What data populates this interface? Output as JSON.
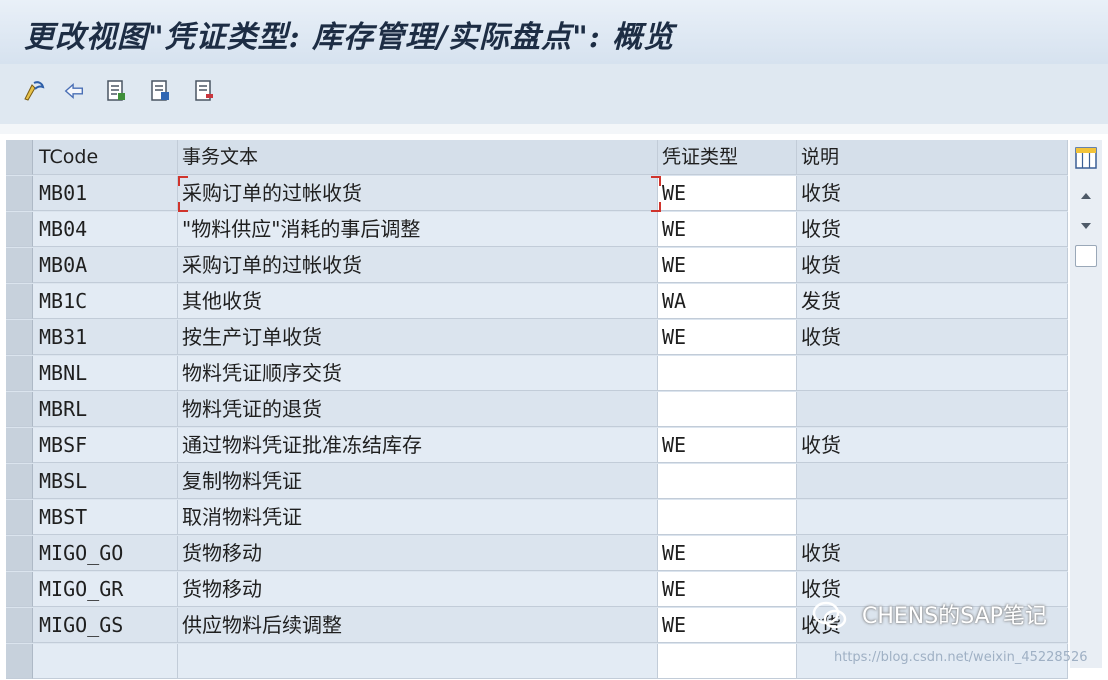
{
  "title": "更改视图\"凭证类型: 库存管理/实际盘点\": 概览",
  "toolbar": {
    "icons": [
      "edit-icon",
      "undo-icon",
      "new-entries-icon",
      "copy-icon",
      "delete-icon"
    ]
  },
  "table": {
    "headers": [
      "TCode",
      "事务文本",
      "凭证类型",
      "说明"
    ],
    "rows": [
      {
        "tcode": "MB01",
        "text": "采购订单的过帐收货",
        "doctype": "WE",
        "desc": "收货"
      },
      {
        "tcode": "MB04",
        "text": "\"物料供应\"消耗的事后调整",
        "doctype": "WE",
        "desc": "收货"
      },
      {
        "tcode": "MB0A",
        "text": "采购订单的过帐收货",
        "doctype": "WE",
        "desc": "收货"
      },
      {
        "tcode": "MB1C",
        "text": "其他收货",
        "doctype": "WA",
        "desc": "发货"
      },
      {
        "tcode": "MB31",
        "text": "按生产订单收货",
        "doctype": "WE",
        "desc": "收货"
      },
      {
        "tcode": "MBNL",
        "text": "物料凭证顺序交货",
        "doctype": "",
        "desc": ""
      },
      {
        "tcode": "MBRL",
        "text": "物料凭证的退货",
        "doctype": "",
        "desc": ""
      },
      {
        "tcode": "MBSF",
        "text": "通过物料凭证批准冻结库存",
        "doctype": "WE",
        "desc": "收货"
      },
      {
        "tcode": "MBSL",
        "text": "复制物料凭证",
        "doctype": "",
        "desc": ""
      },
      {
        "tcode": "MBST",
        "text": "取消物料凭证",
        "doctype": "",
        "desc": ""
      },
      {
        "tcode": "MIGO_GO",
        "text": "货物移动",
        "doctype": "WE",
        "desc": "收货"
      },
      {
        "tcode": "MIGO_GR",
        "text": "货物移动",
        "doctype": "WE",
        "desc": "收货"
      },
      {
        "tcode": "MIGO_GS",
        "text": "供应物料后续调整",
        "doctype": "WE",
        "desc": "收货"
      },
      {
        "tcode": "",
        "text": "",
        "doctype": "",
        "desc": ""
      }
    ]
  },
  "watermark": {
    "brand": "CHENS的SAP笔记",
    "url": "https://blog.csdn.net/weixin_45228526"
  },
  "colors": {
    "title_bg": "#dfe8f1",
    "grid_bg": "#dbe4ee",
    "input_bg": "#ffffff",
    "focus_marker": "#d0342c"
  }
}
